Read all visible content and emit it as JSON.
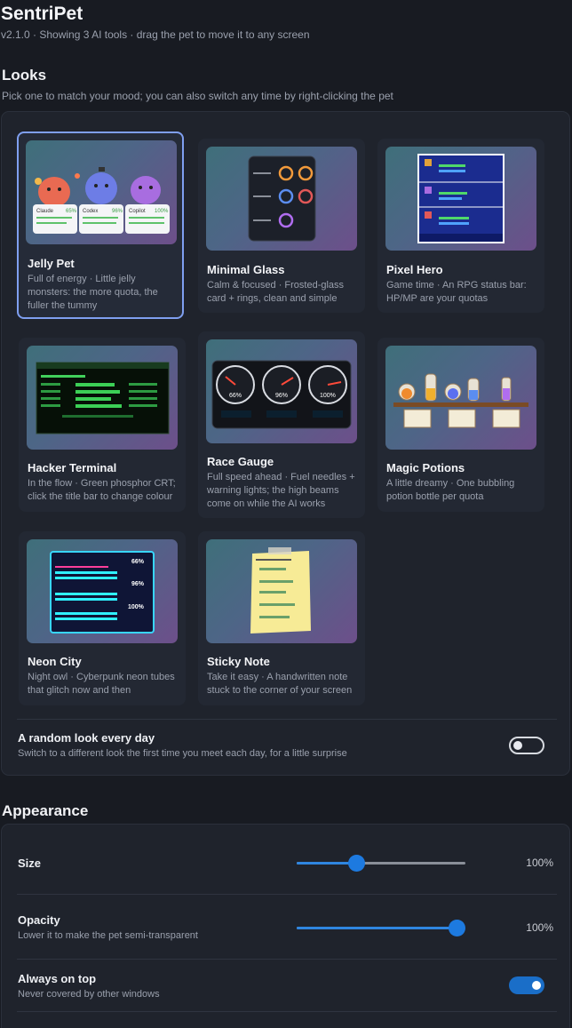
{
  "app": {
    "title": "SentriPet",
    "subtitle": "v2.1.0 · Showing 3 AI tools · drag the pet to move it to any screen"
  },
  "looks": {
    "title": "Looks",
    "description": "Pick one to match your mood; you can also switch any time by right-clicking the pet",
    "cards": [
      {
        "name": "Jelly Pet",
        "desc": "Full of energy · Little jelly monsters: the more quota, the fuller the tummy"
      },
      {
        "name": "Minimal Glass",
        "desc": "Calm & focused · Frosted-glass card + rings, clean and simple"
      },
      {
        "name": "Pixel Hero",
        "desc": "Game time · An RPG status bar: HP/MP are your quotas"
      },
      {
        "name": "Hacker Terminal",
        "desc": "In the flow · Green phosphor CRT; click the title bar to change colour"
      },
      {
        "name": "Race Gauge",
        "desc": "Full speed ahead · Fuel needles + warning lights; the high beams come on while the AI works"
      },
      {
        "name": "Magic Potions",
        "desc": "A little dreamy · One bubbling potion bottle per quota"
      },
      {
        "name": "Neon City",
        "desc": "Night owl · Cyberpunk neon tubes that glitch now and then"
      },
      {
        "name": "Sticky Note",
        "desc": "Take it easy · A handwritten note stuck to the corner of your screen"
      }
    ],
    "random": {
      "label": "A random look every day",
      "desc": "Switch to a different look the first time you meet each day, for a little surprise"
    }
  },
  "preview": {
    "tools": [
      "Claude",
      "Codex",
      "Copilot"
    ],
    "jelly_pcts": [
      "65%",
      "96%",
      "100%"
    ],
    "gauge_pcts": [
      "66%",
      "96%",
      "100%"
    ],
    "neon_pcts": [
      "66%",
      "96%",
      "100%"
    ]
  },
  "appearance": {
    "title": "Appearance",
    "size": {
      "label": "Size",
      "value_text": "100%",
      "level": 0.35
    },
    "opacity": {
      "label": "Opacity",
      "desc": "Lower it to make the pet semi-transparent",
      "value_text": "100%",
      "level": 1.0
    },
    "always_on_top": {
      "label": "Always on top",
      "desc": "Never covered by other windows",
      "on": true
    }
  }
}
